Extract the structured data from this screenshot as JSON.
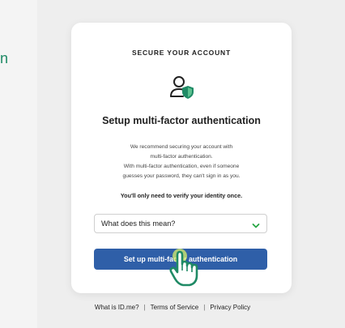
{
  "left_fragment": "n",
  "card": {
    "eyebrow": "SECURE YOUR ACCOUNT",
    "heading": "Setup multi-factor authentication",
    "description_lines": [
      "We recommend securing your account with",
      "multi-factor authentication.",
      "With multi-factor authentication, even if someone",
      "guesses your password, they can't sign in as you."
    ],
    "note": "You'll only need to verify your identity once.",
    "accordion_label": "What does this mean?",
    "cta_label": "Set up multi-factor authentication"
  },
  "footer": {
    "links": [
      "What is ID.me?",
      "Terms of Service",
      "Privacy Policy"
    ],
    "separator": "|"
  },
  "icons": {
    "account_security": "user-shield-icon",
    "accordion": "chevron-down-icon",
    "cursor": "hand-pointer-icon"
  },
  "colors": {
    "accent_green": "#1f8a65",
    "button_blue": "#2f5fa8",
    "chevron_green": "#28a745"
  }
}
